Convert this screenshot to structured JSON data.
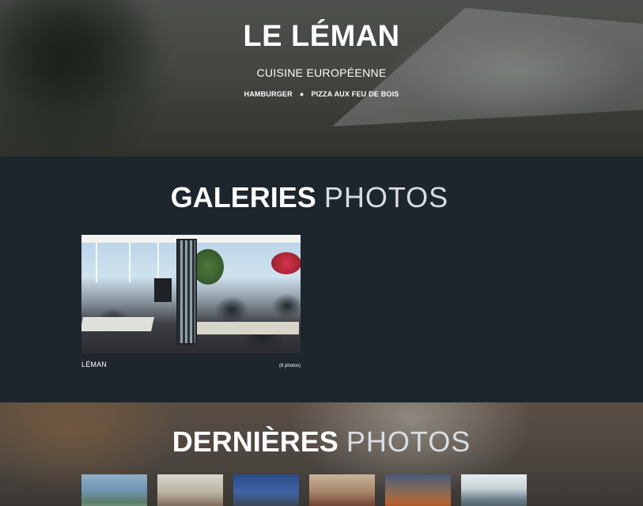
{
  "hero": {
    "title": "LE LÉMAN",
    "subtitle": "CUISINE EUROPÉENNE",
    "tags": [
      "HAMBURGER",
      "PIZZA AUX FEU DE BOIS"
    ],
    "separator": "●"
  },
  "gallery_section": {
    "heading_bold": "GALERIES",
    "heading_light": "PHOTOS",
    "albums": [
      {
        "name": "LÉMAN",
        "count": "(6 photos)"
      }
    ]
  },
  "latest_section": {
    "heading_bold": "DERNIÈRES",
    "heading_light": "PHOTOS",
    "thumbnail_count": 6
  }
}
